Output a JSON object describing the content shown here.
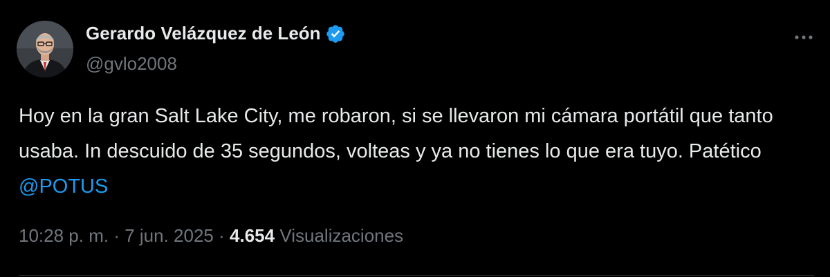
{
  "author": {
    "name": "Gerardo Velázquez de León",
    "handle": "@gvlo2008",
    "verified": true
  },
  "tweet": {
    "text_before_mention": "Hoy en la gran Salt Lake City, me robaron, si se llevaron mi cámara portátil que tanto usaba. In descuido de 35 segundos, volteas y ya no tienes lo que era tuyo. Patético ",
    "mention": "@POTUS"
  },
  "meta": {
    "time": "10:28 p. m.",
    "separator": "·",
    "date": "7 jun. 2025",
    "views_count": "4.654",
    "views_label": "Visualizaciones"
  },
  "icons": {
    "verified": "verified-badge-icon",
    "more": "more-options-icon"
  },
  "colors": {
    "background": "#000000",
    "text_primary": "#e7e9ea",
    "text_secondary": "#71767b",
    "accent": "#1d9bf0",
    "divider": "#2f3336"
  }
}
